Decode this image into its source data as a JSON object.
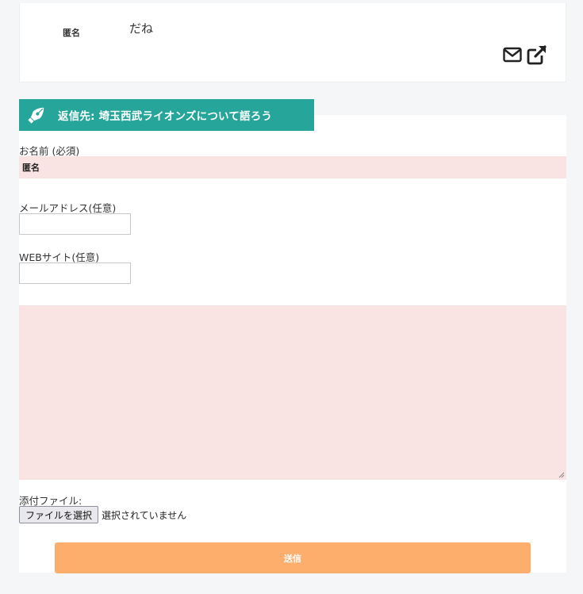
{
  "comment": {
    "author": "匿名",
    "text": "だね",
    "icons": [
      "mail-icon",
      "external-link-icon"
    ]
  },
  "reply": {
    "icon": "pen-icon",
    "title": "返信先: 埼玉西武ライオンズについて語ろう"
  },
  "form": {
    "name_label": "お名前 (必須)",
    "name_value": "匿名",
    "email_label": "メールアドレス(任意)",
    "email_value": "",
    "website_label": "WEBサイト(任意)",
    "website_value": "",
    "body_value": "",
    "attachment_label": "添付ファイル:",
    "file_button_label": "ファイルを選択",
    "file_status": "選択されていません",
    "submit_label": "送信"
  },
  "colors": {
    "banner": "#26a69a",
    "field_fill": "#fae3e3",
    "submit": "#fdae6d"
  }
}
